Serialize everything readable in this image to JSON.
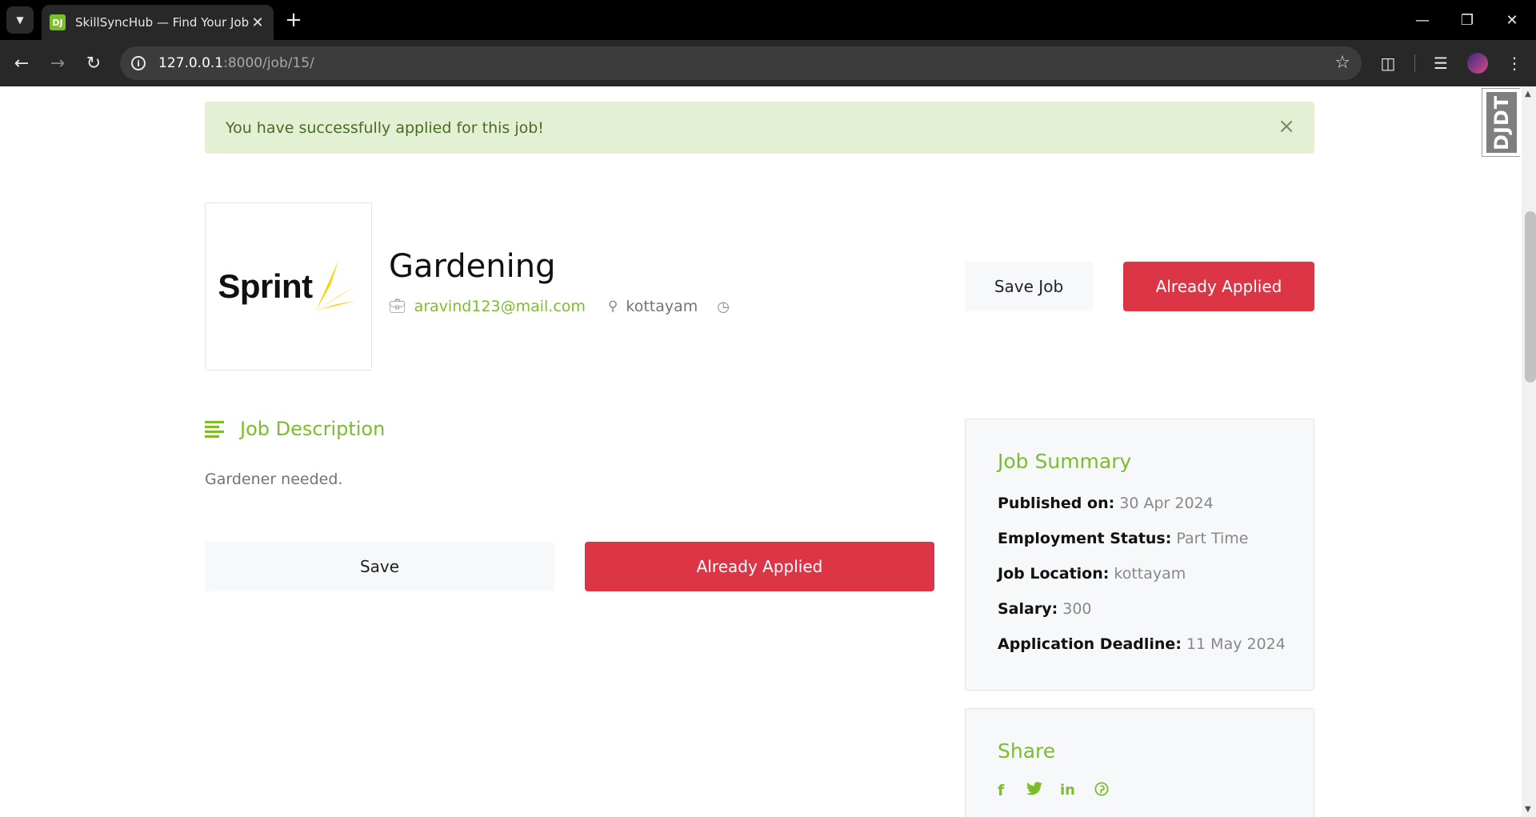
{
  "browser": {
    "tab_title": "SkillSyncHub — Find Your Job",
    "favicon_text": "DJ",
    "url_host": "127.0.0.1",
    "url_path": ":8000/job/15/"
  },
  "debug_toolbar": {
    "label": "DJDT"
  },
  "alert": {
    "message": "You have successfully applied for this job!",
    "close": "×"
  },
  "job": {
    "company_logo_text": "Sprint",
    "title": "Gardening",
    "email": "aravind123@mail.com",
    "location": "kottayam",
    "save_job_label": "Save Job",
    "applied_label": "Already Applied"
  },
  "description": {
    "heading": "Job Description",
    "text": "Gardener needed.",
    "save_label": "Save",
    "applied_label": "Already Applied"
  },
  "summary": {
    "heading": "Job Summary",
    "published_label": "Published on:",
    "published_value": "30 Apr 2024",
    "status_label": "Employment Status:",
    "status_value": "Part Time",
    "location_label": "Job Location:",
    "location_value": "kottayam",
    "salary_label": "Salary:",
    "salary_value": "300",
    "deadline_label": "Application Deadline:",
    "deadline_value": "11 May 2024"
  },
  "share": {
    "heading": "Share",
    "icons": [
      "facebook-icon",
      "twitter-icon",
      "linkedin-icon",
      "pinterest-icon"
    ]
  },
  "colors": {
    "accent": "#7cbd2c",
    "danger": "#dc3545",
    "alert_bg": "#e4f0d3"
  }
}
